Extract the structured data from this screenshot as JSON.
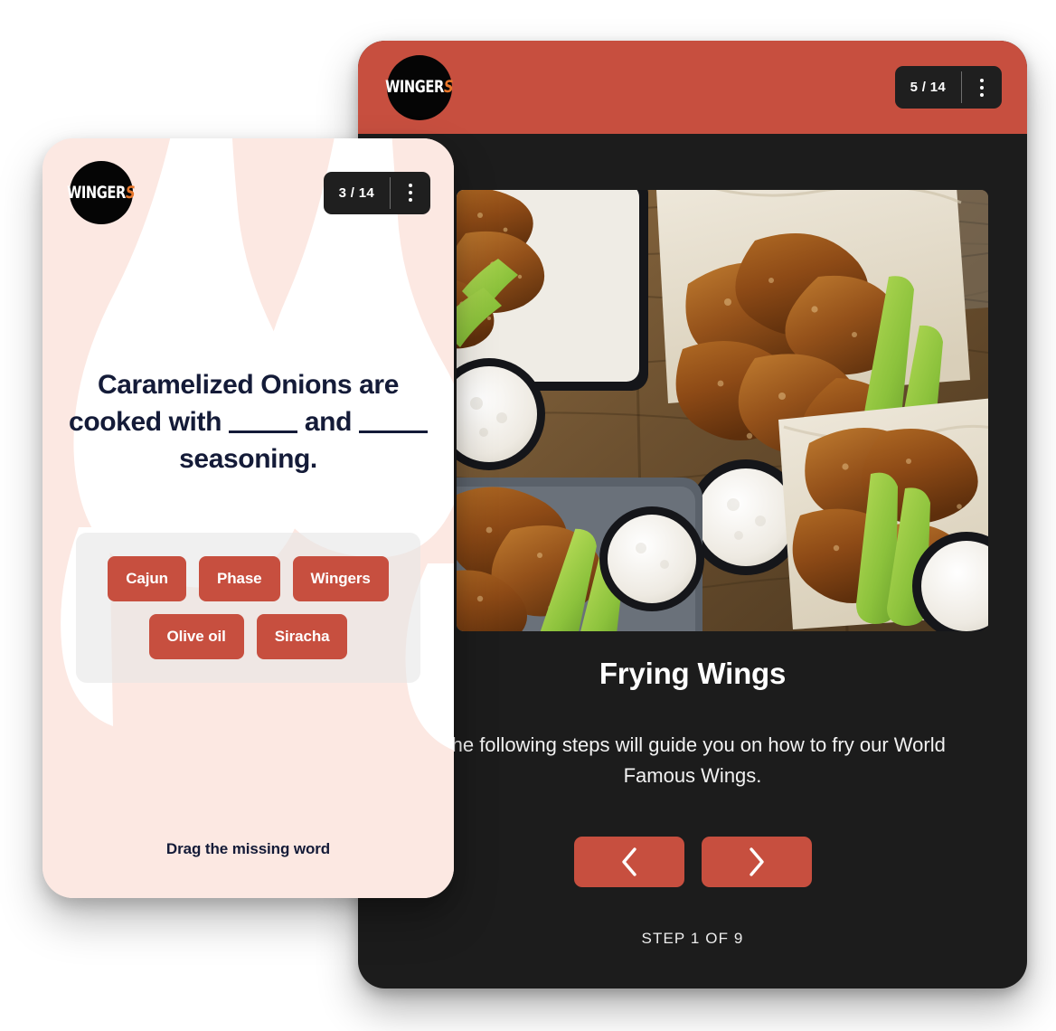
{
  "brand": {
    "name": "WINGERS",
    "name_main": "WINGER",
    "name_accent": "S",
    "accent_color": "#C74F3F",
    "logo_accent_color": "#E8762A",
    "dark_color": "#1C1C1C",
    "navy_text_color": "#141B38",
    "card_pink_color": "#FDEAE4"
  },
  "lesson_panel": {
    "header": {
      "logo_alt": "WINGERS",
      "page_indicator": "5 / 14",
      "menu_icon": "kebab-menu-icon"
    },
    "photo_alt": "Chicken wings with celery sticks and ranch dipping sauce on a wooden table",
    "title": "Frying Wings",
    "subtitle": "The following steps will guide you on how to fry our World Famous Wings.",
    "prev_icon": "chevron-left-icon",
    "next_icon": "chevron-right-icon",
    "step_label": "STEP 1 OF 9"
  },
  "quiz_card": {
    "header": {
      "logo_alt": "WINGERS",
      "page_indicator": "3 / 14",
      "menu_icon": "kebab-menu-icon"
    },
    "question_part_1": "Caramelized Onions are cooked with",
    "question_part_2": "and",
    "question_part_3": "seasoning.",
    "question_full": "Caramelized Onions are cooked with ______ and ______ seasoning.",
    "chips": [
      {
        "label": "Cajun"
      },
      {
        "label": "Phase"
      },
      {
        "label": "Wingers"
      },
      {
        "label": "Olive oil"
      },
      {
        "label": "Siracha"
      }
    ],
    "hint": "Drag the missing word"
  }
}
